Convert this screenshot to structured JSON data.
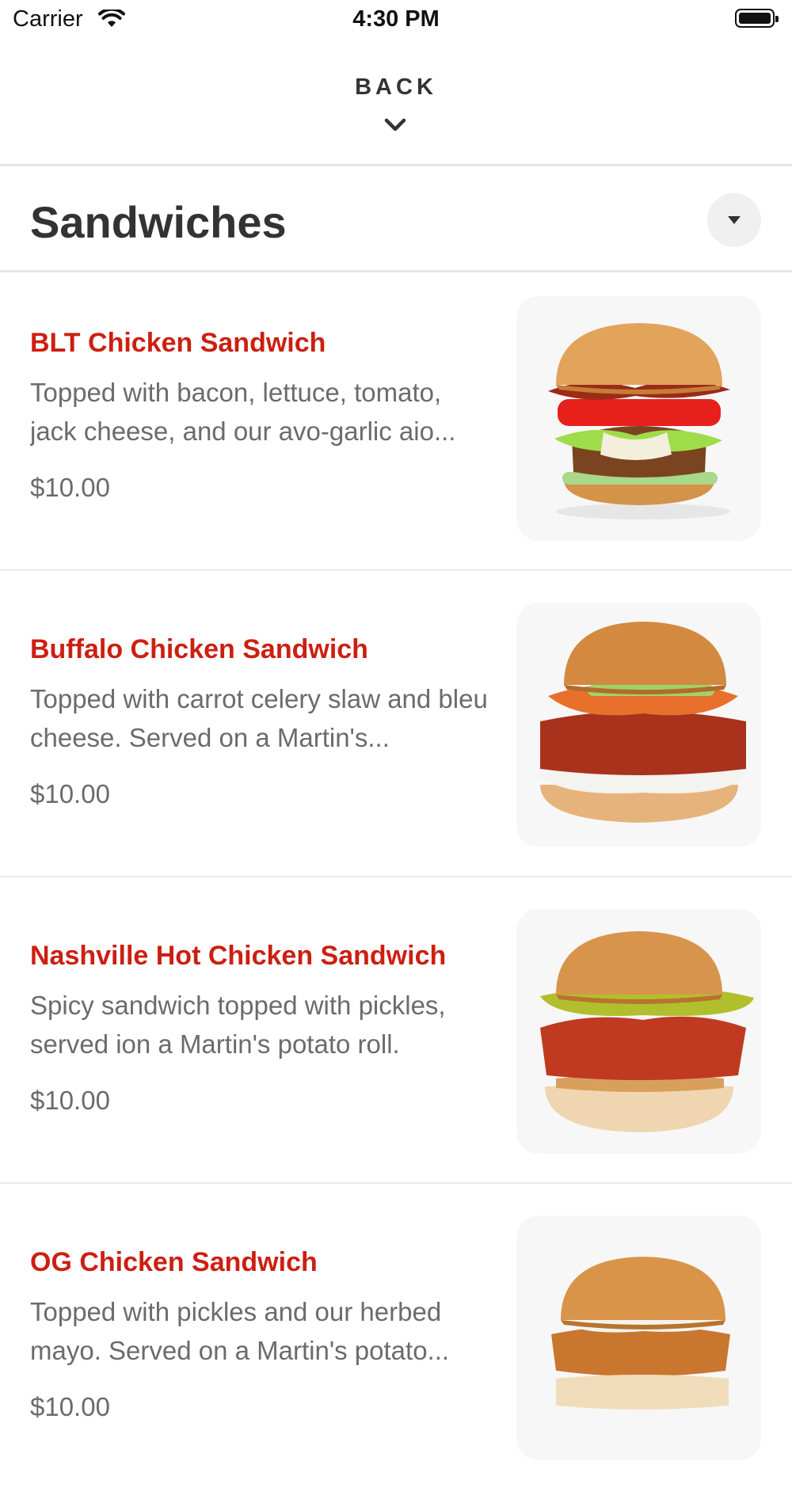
{
  "status_bar": {
    "carrier": "Carrier",
    "time": "4:30 PM"
  },
  "header": {
    "back_label": "BACK"
  },
  "section": {
    "title": "Sandwiches"
  },
  "items": [
    {
      "name": "BLT Chicken Sandwich",
      "description": "Topped with bacon, lettuce, tomato, jack cheese, and our avo-garlic aio...",
      "price": "$10.00"
    },
    {
      "name": "Buffalo Chicken Sandwich",
      "description": "Topped with carrot celery slaw and bleu cheese. Served on a Martin's...",
      "price": "$10.00"
    },
    {
      "name": "Nashville Hot Chicken Sandwich",
      "description": "Spicy sandwich topped with pickles, served ion a Martin's potato roll.",
      "price": "$10.00"
    },
    {
      "name": "OG Chicken Sandwich",
      "description": "Topped with pickles and our herbed mayo. Served on a Martin's potato...",
      "price": "$10.00"
    }
  ],
  "colors": {
    "item_name": "#cc1f11",
    "text_secondary": "#6b6b6b",
    "title": "#333333"
  },
  "icons": {
    "wifi": "wifi-icon",
    "battery": "battery-icon",
    "back": "chevron-down-icon",
    "collapse": "caret-down-icon"
  }
}
